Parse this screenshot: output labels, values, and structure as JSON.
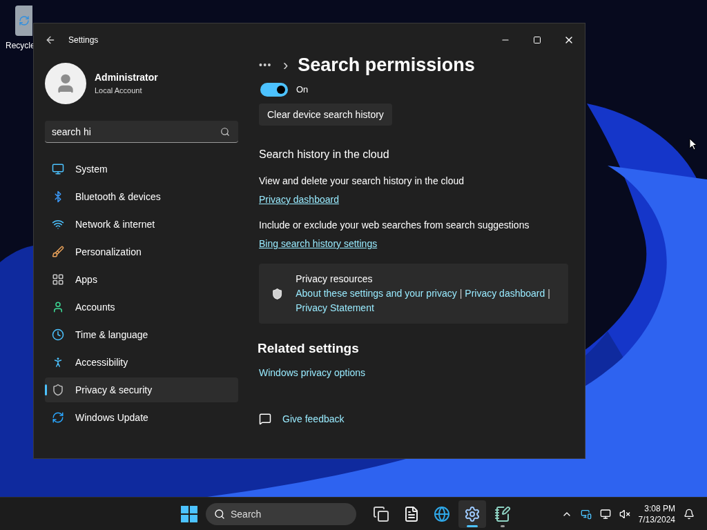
{
  "desktop": {
    "icons": [
      {
        "label": "Recycle"
      }
    ]
  },
  "window": {
    "title": "Settings"
  },
  "account": {
    "name": "Administrator",
    "type": "Local Account"
  },
  "search": {
    "value": "search hi"
  },
  "nav": [
    {
      "label": "System",
      "selected": false
    },
    {
      "label": "Bluetooth & devices",
      "selected": false
    },
    {
      "label": "Network & internet",
      "selected": false
    },
    {
      "label": "Personalization",
      "selected": false
    },
    {
      "label": "Apps",
      "selected": false
    },
    {
      "label": "Accounts",
      "selected": false
    },
    {
      "label": "Time & language",
      "selected": false
    },
    {
      "label": "Accessibility",
      "selected": false
    },
    {
      "label": "Privacy & security",
      "selected": true
    },
    {
      "label": "Windows Update",
      "selected": false
    }
  ],
  "breadcrumb": {
    "ellipsis": "•••",
    "separator": "›",
    "title": "Search permissions"
  },
  "toggle": {
    "on": true,
    "label": "On"
  },
  "clear_button": "Clear device search history",
  "cloud": {
    "heading": "Search history in the cloud",
    "items": [
      {
        "text": "View and delete your search history in the cloud",
        "link": "Privacy dashboard"
      },
      {
        "text": "Include or exclude your web searches from search suggestions",
        "link": "Bing search history settings"
      }
    ]
  },
  "resources": {
    "title": "Privacy resources",
    "links": [
      "About these settings and your privacy",
      "Privacy dashboard",
      "Privacy Statement"
    ],
    "separator": "|"
  },
  "related": {
    "heading": "Related settings",
    "links": [
      "Windows privacy options"
    ]
  },
  "feedback": "Give feedback",
  "taskbar": {
    "search_placeholder": "Search",
    "apps": [
      {
        "kind": "taskview",
        "selected": false,
        "running": false
      },
      {
        "kind": "file",
        "selected": false,
        "running": false
      },
      {
        "kind": "browser",
        "selected": false,
        "running": false
      },
      {
        "kind": "settings",
        "selected": true,
        "running": true
      },
      {
        "kind": "notepad",
        "selected": false,
        "running": true
      }
    ],
    "time": "3:08 PM",
    "date": "7/13/2024"
  }
}
